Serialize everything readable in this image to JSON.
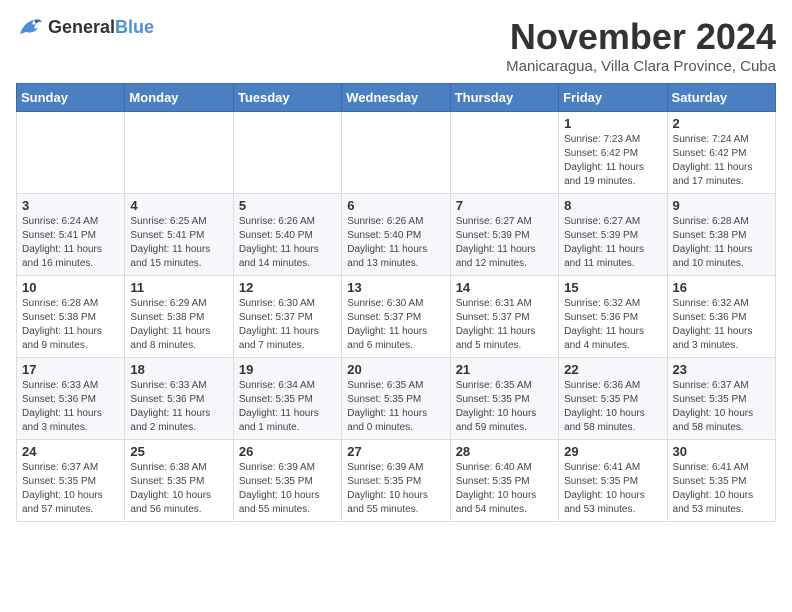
{
  "logo": {
    "general": "General",
    "blue": "Blue"
  },
  "title": "November 2024",
  "location": "Manicaragua, Villa Clara Province, Cuba",
  "weekdays": [
    "Sunday",
    "Monday",
    "Tuesday",
    "Wednesday",
    "Thursday",
    "Friday",
    "Saturday"
  ],
  "weeks": [
    [
      {
        "day": "",
        "info": ""
      },
      {
        "day": "",
        "info": ""
      },
      {
        "day": "",
        "info": ""
      },
      {
        "day": "",
        "info": ""
      },
      {
        "day": "",
        "info": ""
      },
      {
        "day": "1",
        "info": "Sunrise: 7:23 AM\nSunset: 6:42 PM\nDaylight: 11 hours and 19 minutes."
      },
      {
        "day": "2",
        "info": "Sunrise: 7:24 AM\nSunset: 6:42 PM\nDaylight: 11 hours and 17 minutes."
      }
    ],
    [
      {
        "day": "3",
        "info": "Sunrise: 6:24 AM\nSunset: 5:41 PM\nDaylight: 11 hours and 16 minutes."
      },
      {
        "day": "4",
        "info": "Sunrise: 6:25 AM\nSunset: 5:41 PM\nDaylight: 11 hours and 15 minutes."
      },
      {
        "day": "5",
        "info": "Sunrise: 6:26 AM\nSunset: 5:40 PM\nDaylight: 11 hours and 14 minutes."
      },
      {
        "day": "6",
        "info": "Sunrise: 6:26 AM\nSunset: 5:40 PM\nDaylight: 11 hours and 13 minutes."
      },
      {
        "day": "7",
        "info": "Sunrise: 6:27 AM\nSunset: 5:39 PM\nDaylight: 11 hours and 12 minutes."
      },
      {
        "day": "8",
        "info": "Sunrise: 6:27 AM\nSunset: 5:39 PM\nDaylight: 11 hours and 11 minutes."
      },
      {
        "day": "9",
        "info": "Sunrise: 6:28 AM\nSunset: 5:38 PM\nDaylight: 11 hours and 10 minutes."
      }
    ],
    [
      {
        "day": "10",
        "info": "Sunrise: 6:28 AM\nSunset: 5:38 PM\nDaylight: 11 hours and 9 minutes."
      },
      {
        "day": "11",
        "info": "Sunrise: 6:29 AM\nSunset: 5:38 PM\nDaylight: 11 hours and 8 minutes."
      },
      {
        "day": "12",
        "info": "Sunrise: 6:30 AM\nSunset: 5:37 PM\nDaylight: 11 hours and 7 minutes."
      },
      {
        "day": "13",
        "info": "Sunrise: 6:30 AM\nSunset: 5:37 PM\nDaylight: 11 hours and 6 minutes."
      },
      {
        "day": "14",
        "info": "Sunrise: 6:31 AM\nSunset: 5:37 PM\nDaylight: 11 hours and 5 minutes."
      },
      {
        "day": "15",
        "info": "Sunrise: 6:32 AM\nSunset: 5:36 PM\nDaylight: 11 hours and 4 minutes."
      },
      {
        "day": "16",
        "info": "Sunrise: 6:32 AM\nSunset: 5:36 PM\nDaylight: 11 hours and 3 minutes."
      }
    ],
    [
      {
        "day": "17",
        "info": "Sunrise: 6:33 AM\nSunset: 5:36 PM\nDaylight: 11 hours and 3 minutes."
      },
      {
        "day": "18",
        "info": "Sunrise: 6:33 AM\nSunset: 5:36 PM\nDaylight: 11 hours and 2 minutes."
      },
      {
        "day": "19",
        "info": "Sunrise: 6:34 AM\nSunset: 5:35 PM\nDaylight: 11 hours and 1 minute."
      },
      {
        "day": "20",
        "info": "Sunrise: 6:35 AM\nSunset: 5:35 PM\nDaylight: 11 hours and 0 minutes."
      },
      {
        "day": "21",
        "info": "Sunrise: 6:35 AM\nSunset: 5:35 PM\nDaylight: 10 hours and 59 minutes."
      },
      {
        "day": "22",
        "info": "Sunrise: 6:36 AM\nSunset: 5:35 PM\nDaylight: 10 hours and 58 minutes."
      },
      {
        "day": "23",
        "info": "Sunrise: 6:37 AM\nSunset: 5:35 PM\nDaylight: 10 hours and 58 minutes."
      }
    ],
    [
      {
        "day": "24",
        "info": "Sunrise: 6:37 AM\nSunset: 5:35 PM\nDaylight: 10 hours and 57 minutes."
      },
      {
        "day": "25",
        "info": "Sunrise: 6:38 AM\nSunset: 5:35 PM\nDaylight: 10 hours and 56 minutes."
      },
      {
        "day": "26",
        "info": "Sunrise: 6:39 AM\nSunset: 5:35 PM\nDaylight: 10 hours and 55 minutes."
      },
      {
        "day": "27",
        "info": "Sunrise: 6:39 AM\nSunset: 5:35 PM\nDaylight: 10 hours and 55 minutes."
      },
      {
        "day": "28",
        "info": "Sunrise: 6:40 AM\nSunset: 5:35 PM\nDaylight: 10 hours and 54 minutes."
      },
      {
        "day": "29",
        "info": "Sunrise: 6:41 AM\nSunset: 5:35 PM\nDaylight: 10 hours and 53 minutes."
      },
      {
        "day": "30",
        "info": "Sunrise: 6:41 AM\nSunset: 5:35 PM\nDaylight: 10 hours and 53 minutes."
      }
    ]
  ]
}
